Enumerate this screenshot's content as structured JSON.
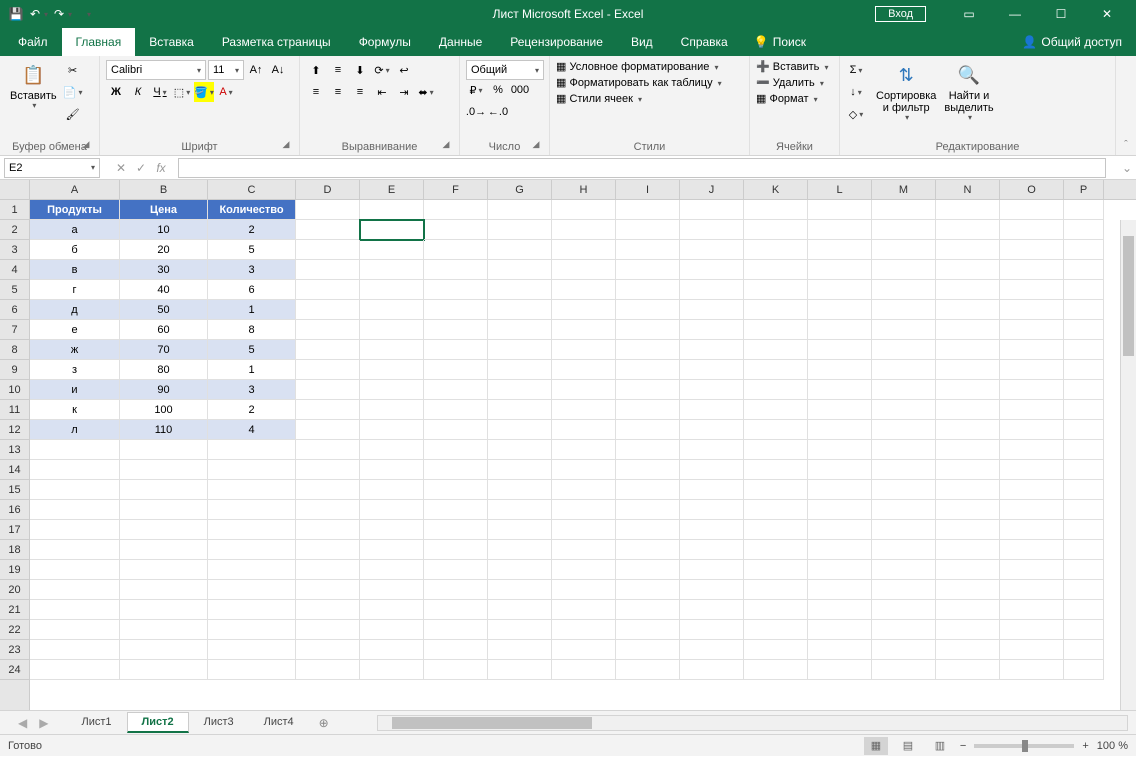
{
  "title": "Лист Microsoft Excel  -  Excel",
  "titlebar": {
    "signin": "Вход"
  },
  "tabs": [
    "Файл",
    "Главная",
    "Вставка",
    "Разметка страницы",
    "Формулы",
    "Данные",
    "Рецензирование",
    "Вид",
    "Справка"
  ],
  "active_tab": "Главная",
  "tell_me": "Поиск",
  "share": "Общий доступ",
  "ribbon": {
    "clipboard": {
      "paste": "Вставить",
      "label": "Буфер обмена"
    },
    "font": {
      "name": "Calibri",
      "size": "11",
      "bold": "Ж",
      "italic": "К",
      "underline": "Ч",
      "label": "Шрифт"
    },
    "align": {
      "label": "Выравнивание"
    },
    "number": {
      "format": "Общий",
      "label": "Число"
    },
    "styles": {
      "cond": "Условное форматирование",
      "table": "Форматировать как таблицу",
      "cell": "Стили ячеек",
      "label": "Стили"
    },
    "cells": {
      "insert": "Вставить",
      "delete": "Удалить",
      "format": "Формат",
      "label": "Ячейки"
    },
    "editing": {
      "sort": "Сортировка\nи фильтр",
      "find": "Найти и\nвыделить",
      "label": "Редактирование"
    }
  },
  "namebox": "E2",
  "columns": [
    "A",
    "B",
    "C",
    "D",
    "E",
    "F",
    "G",
    "H",
    "I",
    "J",
    "K",
    "L",
    "M",
    "N",
    "O",
    "P"
  ],
  "table_headers": [
    "Продукты",
    "Цена",
    "Количество"
  ],
  "table_rows": [
    [
      "а",
      "10",
      "2"
    ],
    [
      "б",
      "20",
      "5"
    ],
    [
      "в",
      "30",
      "3"
    ],
    [
      "г",
      "40",
      "6"
    ],
    [
      "д",
      "50",
      "1"
    ],
    [
      "е",
      "60",
      "8"
    ],
    [
      "ж",
      "70",
      "5"
    ],
    [
      "з",
      "80",
      "1"
    ],
    [
      "и",
      "90",
      "3"
    ],
    [
      "к",
      "100",
      "2"
    ],
    [
      "л",
      "110",
      "4"
    ]
  ],
  "sheets": [
    "Лист1",
    "Лист2",
    "Лист3",
    "Лист4"
  ],
  "active_sheet": "Лист2",
  "status": "Готово",
  "zoom": "100 %"
}
